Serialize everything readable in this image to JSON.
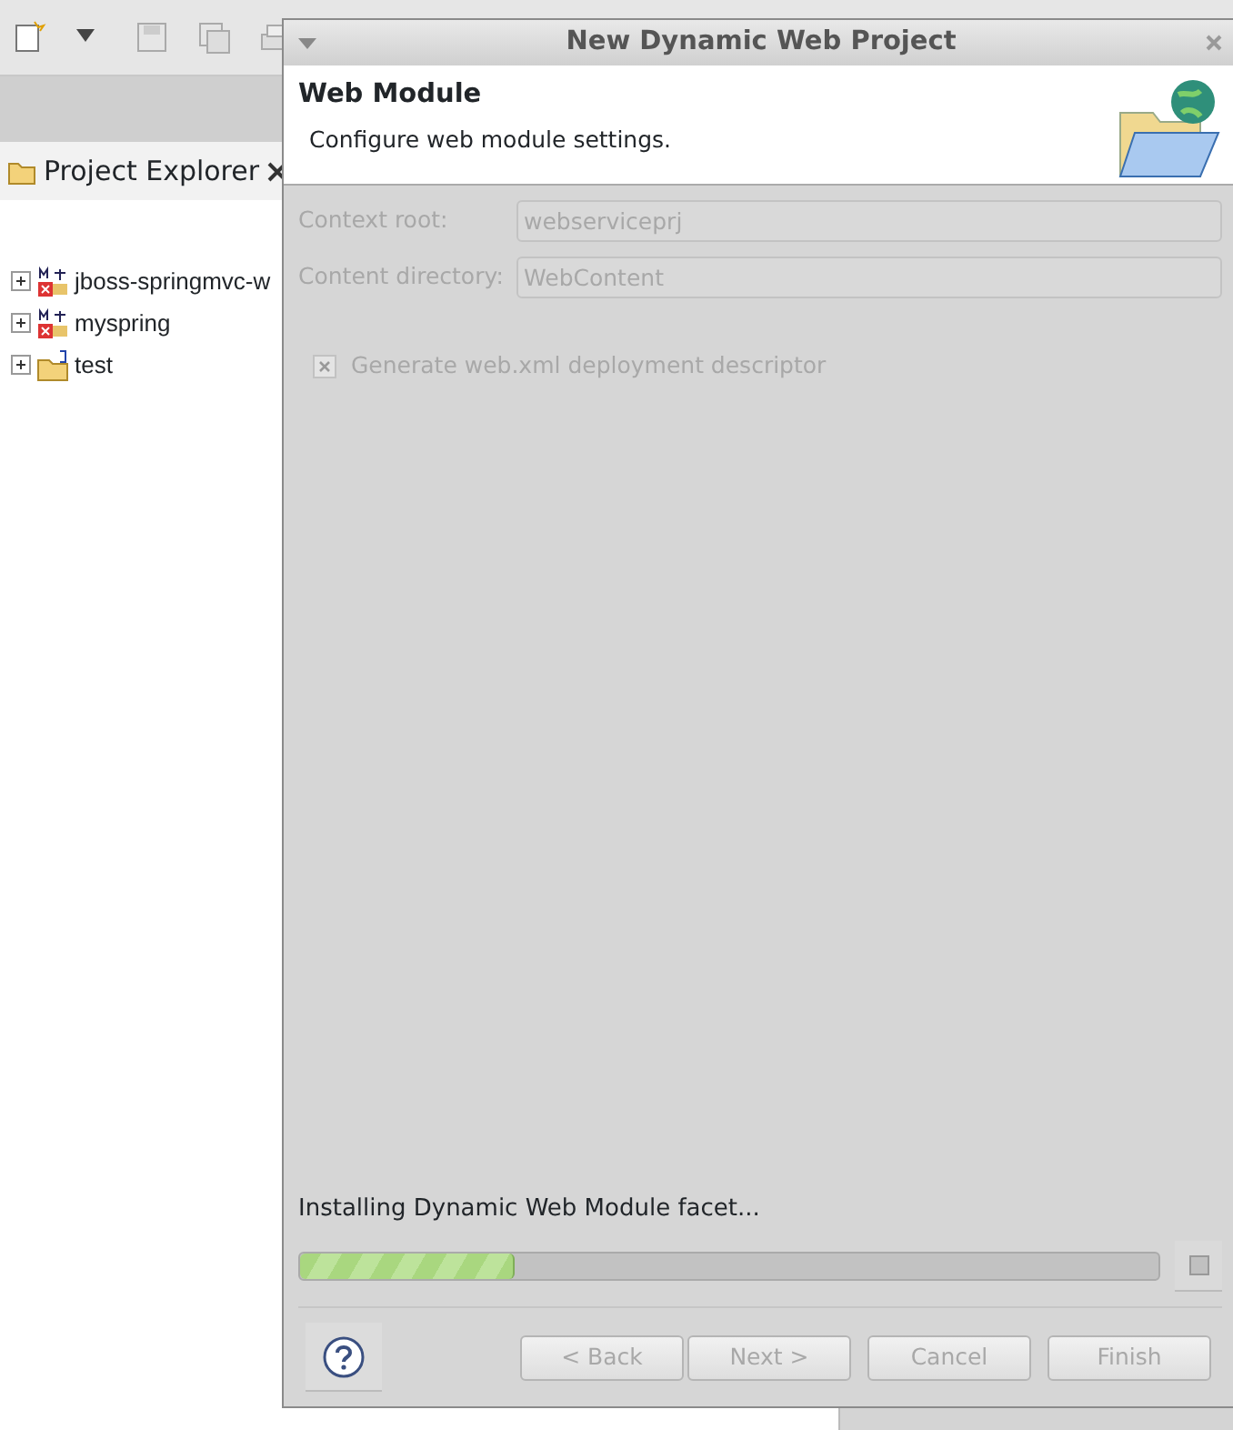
{
  "project_explorer": {
    "title": "Project Explorer",
    "items": [
      {
        "label": "jboss-springmvc-w",
        "kind": "maven",
        "expanded": false
      },
      {
        "label": "myspring",
        "kind": "maven",
        "expanded": false
      },
      {
        "label": "test",
        "kind": "source",
        "expanded": false
      }
    ]
  },
  "dialog": {
    "title": "New Dynamic Web Project",
    "header": {
      "title": "Web Module",
      "description": "Configure web module settings."
    },
    "fields": [
      {
        "label": "Context root:",
        "value": "webserviceprj",
        "disabled": true
      },
      {
        "label": "Content directory:",
        "value": "WebContent",
        "disabled": true
      }
    ],
    "checkbox": {
      "label": "Generate web.xml deployment descriptor",
      "checked": true,
      "disabled": true
    },
    "progress": {
      "label": "Installing Dynamic Web Module facet...",
      "level": 0.25
    },
    "buttons": [
      {
        "label": "< Back",
        "disabled": true
      },
      {
        "label": "Next >",
        "disabled": true
      },
      {
        "label": "Cancel",
        "disabled": true
      },
      {
        "label": "Finish",
        "disabled": true
      }
    ]
  }
}
